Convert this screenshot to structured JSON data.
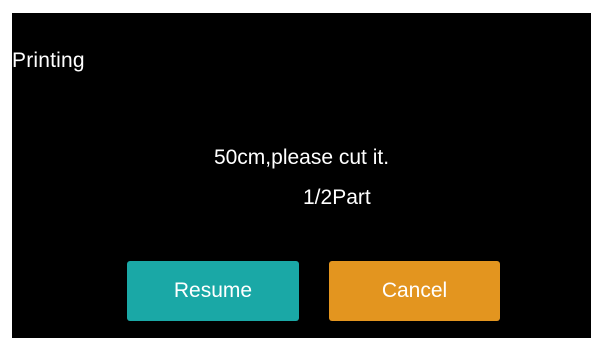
{
  "dialog": {
    "title": "Printing",
    "message": "50cm,please cut it.",
    "part": "1/2Part"
  },
  "buttons": {
    "resume_label": "Resume",
    "cancel_label": "Cancel"
  },
  "colors": {
    "background": "#000000",
    "resume": "#1aa8a6",
    "cancel": "#e3951f",
    "text": "#ffffff"
  }
}
